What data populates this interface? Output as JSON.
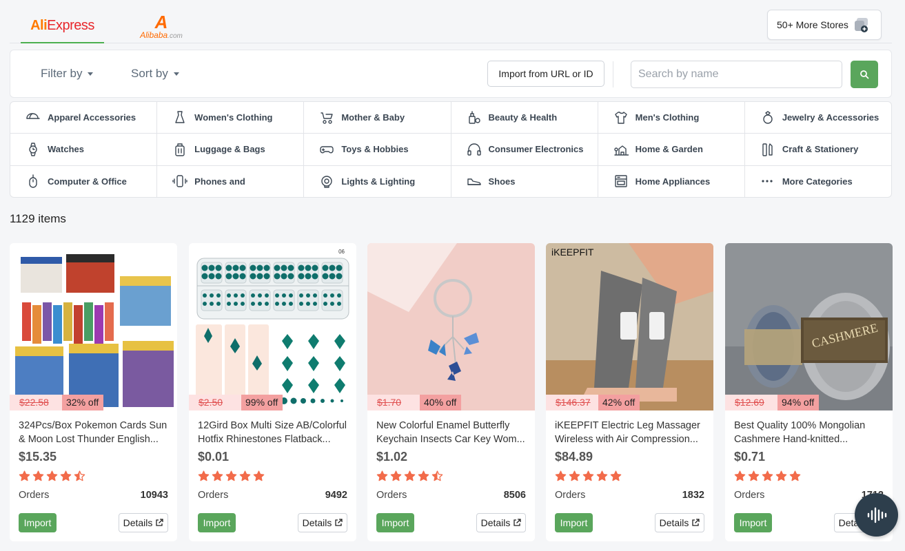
{
  "sources": {
    "aliexpress": "AliExpress",
    "alibaba_mark": "A",
    "alibaba_word": "Alibaba",
    "alibaba_com": ".com",
    "more_stores": "50+ More Stores"
  },
  "toolbar": {
    "filter_label": "Filter by",
    "sort_label": "Sort by",
    "import_url_label": "Import from URL or ID",
    "search_placeholder": "Search by name"
  },
  "categories": [
    {
      "label": "Apparel Accessories",
      "icon": "cap-icon"
    },
    {
      "label": "Women's Clothing",
      "icon": "dress-icon"
    },
    {
      "label": "Mother & Baby",
      "icon": "stroller-icon"
    },
    {
      "label": "Beauty & Health",
      "icon": "beauty-icon"
    },
    {
      "label": "Men's Clothing",
      "icon": "shirt-icon"
    },
    {
      "label": "Jewelry & Accessories",
      "icon": "ring-icon"
    },
    {
      "label": "Watches",
      "icon": "watch-icon"
    },
    {
      "label": "Luggage & Bags",
      "icon": "luggage-icon"
    },
    {
      "label": "Toys & Hobbies",
      "icon": "gamepad-icon"
    },
    {
      "label": "Consumer Electronics",
      "icon": "headphones-icon"
    },
    {
      "label": "Home & Garden",
      "icon": "home-garden-icon"
    },
    {
      "label": "Craft & Stationery",
      "icon": "stationery-icon"
    },
    {
      "label": "Computer & Office",
      "icon": "mouse-icon"
    },
    {
      "label": "Phones and",
      "icon": "phone-icon"
    },
    {
      "label": "Lights & Lighting",
      "icon": "bulb-icon"
    },
    {
      "label": "Shoes",
      "icon": "shoe-icon"
    },
    {
      "label": "Home Appliances",
      "icon": "appliance-icon"
    },
    {
      "label": "More Categories",
      "icon": "more-dots-icon"
    }
  ],
  "item_count": "1129 items",
  "products": [
    {
      "old_price": "$22.58",
      "discount": "32% off",
      "title": "324Pcs/Box Pokemon Cards Sun & Moon Lost Thunder English...",
      "price": "$15.35",
      "rating": 4.5,
      "orders_label": "Orders",
      "orders": "10943",
      "import": "Import",
      "details": "Details"
    },
    {
      "old_price": "$2.50",
      "discount": "99% off",
      "title": "12Gird Box Multi Size AB/Colorful Hotfix Rhinestones Flatback...",
      "price": "$0.01",
      "rating": 5,
      "orders_label": "Orders",
      "orders": "9492",
      "import": "Import",
      "details": "Details",
      "image_text": "06"
    },
    {
      "old_price": "$1.70",
      "discount": "40% off",
      "title": "New Colorful Enamel Butterfly Keychain Insects Car Key Wom...",
      "price": "$1.02",
      "rating": 4.5,
      "orders_label": "Orders",
      "orders": "8506",
      "import": "Import",
      "details": "Details"
    },
    {
      "old_price": "$146.37",
      "discount": "42% off",
      "title": "iKEEPFIT Electric Leg Massager Wireless with Air Compression...",
      "price": "$84.89",
      "rating": 5,
      "orders_label": "Orders",
      "orders": "1832",
      "import": "Import",
      "details": "Details",
      "image_text": "iKEEPFIT"
    },
    {
      "old_price": "$12.69",
      "discount": "94% off",
      "title": "Best Quality 100% Mongolian Cashmere Hand-knitted...",
      "price": "$0.71",
      "rating": 5,
      "orders_label": "Orders",
      "orders": "1712",
      "import": "Import",
      "details": "Details",
      "image_text": "CASHMERE"
    }
  ],
  "colors": {
    "accent_green": "#5aa65c",
    "star": "#f26b4a",
    "discount_bg": "#f3a0a0",
    "old_price": "#e05050"
  }
}
